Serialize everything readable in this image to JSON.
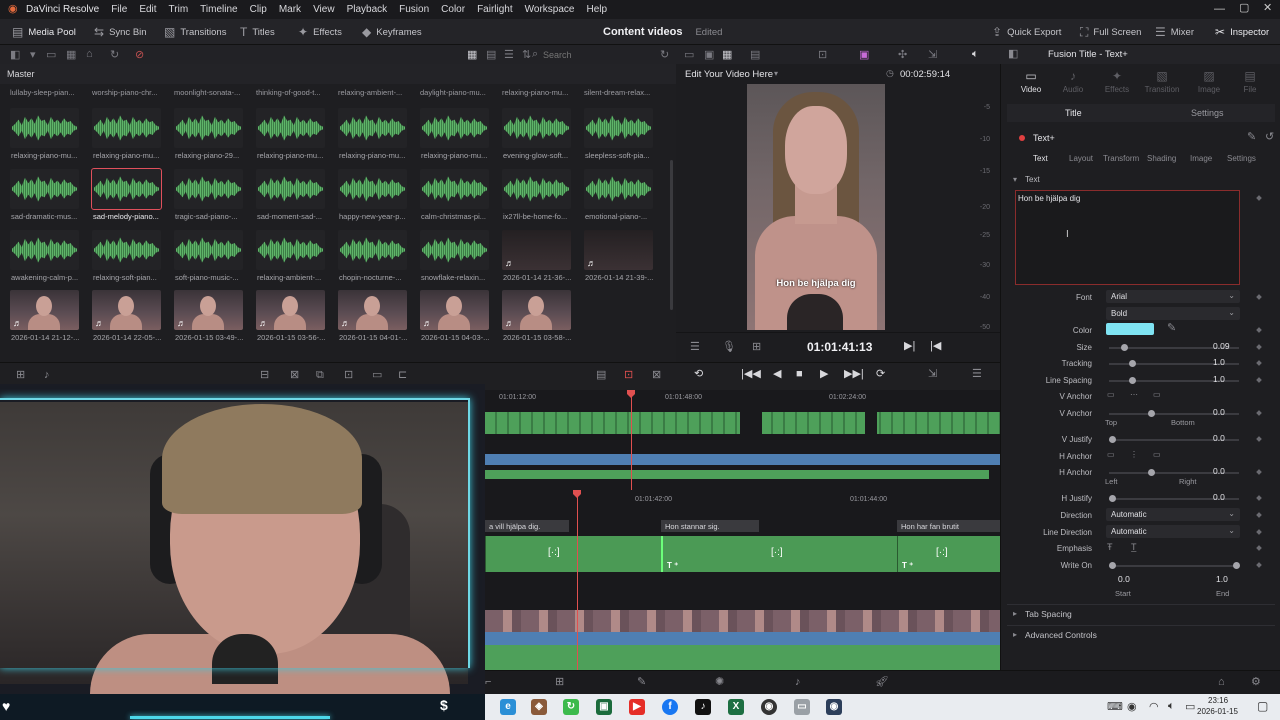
{
  "menubar": {
    "title": "DaVinci Resolve",
    "items": [
      "File",
      "Edit",
      "Trim",
      "Timeline",
      "Clip",
      "Mark",
      "View",
      "Playback",
      "Fusion",
      "Color",
      "Fairlight",
      "Workspace",
      "Help"
    ]
  },
  "toolbar": {
    "media_pool": "Media Pool",
    "sync_bin": "Sync Bin",
    "transitions": "Transitions",
    "titles": "Titles",
    "effects": "Effects",
    "keyframes": "Keyframes",
    "project_name": "Content videos",
    "project_state": "Edited",
    "quick_export": "Quick Export",
    "full_screen": "Full Screen",
    "mixer": "Mixer",
    "inspector": "Inspector"
  },
  "search": {
    "placeholder": "Search"
  },
  "media_pool": {
    "bin": "Master",
    "top_names": [
      "lullaby-sleep-pian...",
      "worship-piano-chr...",
      "moonlight-sonata-...",
      "thinking-of-good-t...",
      "relaxing-ambient-...",
      "daylight-piano-mu...",
      "relaxing-piano-mu...",
      "silent-dream-relax..."
    ],
    "rows": [
      [
        "relaxing-piano-mu...",
        "relaxing-piano-mu...",
        "relaxing-piano-29...",
        "relaxing-piano-mu...",
        "relaxing-piano-mu...",
        "relaxing-piano-mu...",
        "evening-glow-soft...",
        "sleepless-soft-pia..."
      ],
      [
        "sad-dramatic-mus...",
        "sad-melody-piano...",
        "tragic-sad-piano-...",
        "sad-moment-sad-...",
        "happy-new-year-p...",
        "calm-christmas-pi...",
        "ix27ll-be-home-fo...",
        "emotional-piano-..."
      ],
      [
        "awakening-calm-p...",
        "relaxing-soft-pian...",
        "soft-piano-music-...",
        "relaxing-ambient-...",
        "chopin-nocturne-...",
        "snowflake-relaxin...",
        "2026-01-14 21-36-...",
        "2026-01-14 21-39-..."
      ],
      [
        "2026-01-14 21-12-...",
        "2026-01-14 22-05-...",
        "2026-01-15 03-49-...",
        "2026-01-15 03-56-...",
        "2026-01-15 04-01-...",
        "2026-01-15 04-03-...",
        "2026-01-15 03-58-..."
      ]
    ],
    "selected": "sad-melody-piano..."
  },
  "viewer": {
    "title": "Edit Your Video Here",
    "duration": "00:02:59:14",
    "timecode": "01:01:41:13",
    "subtitle": "Hon be hjälpa dig",
    "meter_labels": [
      "-5",
      "-10",
      "-15",
      "-20",
      "-25",
      "-30",
      "-40",
      "-50"
    ]
  },
  "timeline": {
    "upper_ruler": [
      "01:01:12:00",
      "01:01:48:00",
      "01:02:24:00"
    ],
    "lower_ruler": [
      "01:01:42:00",
      "01:01:44:00"
    ],
    "subtitle_clips": [
      "a vill hjälpa dig.",
      "Hon stannar sig.",
      "Hon har fan brutit"
    ]
  },
  "inspector": {
    "title": "Fusion Title - Text+",
    "tabs": [
      "Video",
      "Audio",
      "Effects",
      "Transition",
      "Image",
      "File"
    ],
    "subtabs": [
      "Title",
      "Settings"
    ],
    "node": "Text+",
    "text_tabs": [
      "Text",
      "Layout",
      "Transform",
      "Shading",
      "Image",
      "Settings"
    ],
    "section": "Text",
    "text_value": "Hon be hjälpa dig",
    "font_label": "Font",
    "font": "Arial",
    "style": "Bold",
    "color_label": "Color",
    "color_hex": "#7fe3f2",
    "size_label": "Size",
    "size": "0.09",
    "tracking_label": "Tracking",
    "tracking": "1.0",
    "line_spacing_label": "Line Spacing",
    "line_spacing": "1.0",
    "v_anchor_label": "V Anchor",
    "v_anchor2_label": "V Anchor",
    "v_anchor": "0.0",
    "top": "Top",
    "bottom": "Bottom",
    "v_justify_label": "V Justify",
    "v_justify": "0.0",
    "h_anchor_label": "H Anchor",
    "h_anchor2_label": "H Anchor",
    "h_anchor": "0.0",
    "left": "Left",
    "right": "Right",
    "h_justify_label": "H Justify",
    "h_justify": "0.0",
    "direction_label": "Direction",
    "direction": "Automatic",
    "line_direction_label": "Line Direction",
    "line_direction": "Automatic",
    "emphasis_label": "Emphasis",
    "write_on_label": "Write On",
    "write_start": "0.0",
    "write_end": "1.0",
    "start": "Start",
    "end": "End",
    "tab_spacing": "Tab Spacing",
    "advanced": "Advanced Controls"
  },
  "taskbar": {
    "time": "23:16",
    "date": "2026-01-15"
  }
}
